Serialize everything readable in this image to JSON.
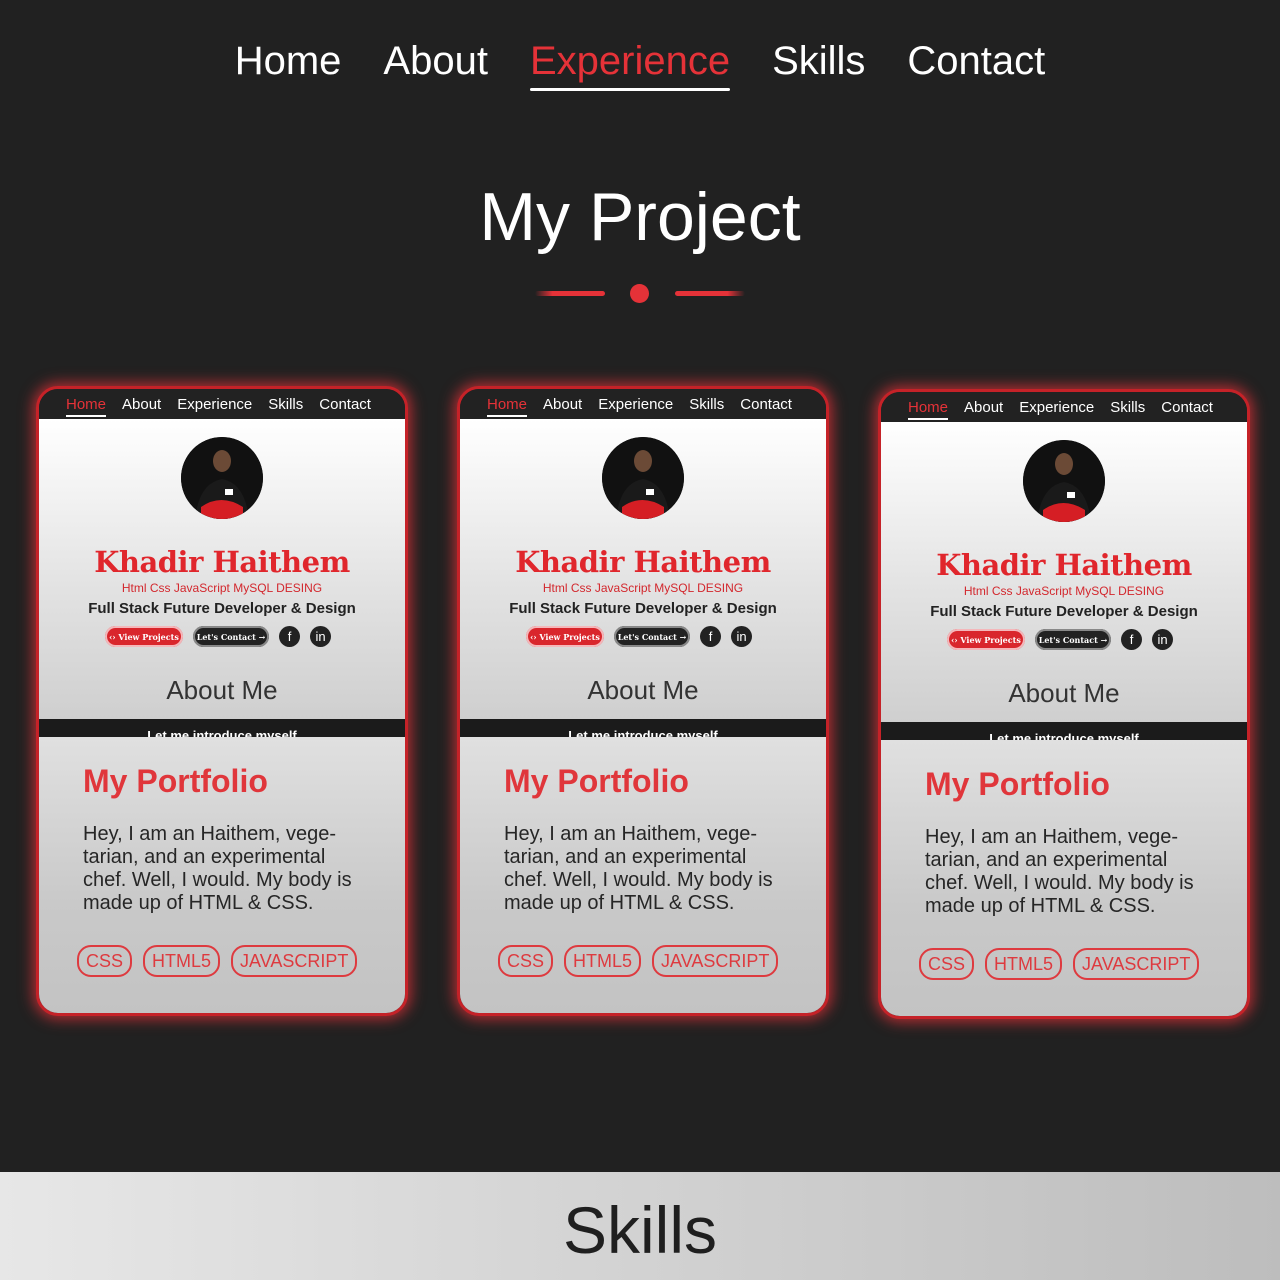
{
  "nav": {
    "items": [
      {
        "label": "Home"
      },
      {
        "label": "About"
      },
      {
        "label": "Experience",
        "active": true
      },
      {
        "label": "Skills"
      },
      {
        "label": "Contact"
      }
    ]
  },
  "section": {
    "title": "My Project"
  },
  "colors": {
    "accent": "#e53238",
    "background": "#212121"
  },
  "cards": [
    {
      "mini_nav": [
        "Home",
        "About",
        "Experience",
        "Skills",
        "Contact"
      ],
      "name": "Khadir Haithem",
      "skills_line": "Html Css JavaScript MySQL DESING",
      "role": "Full Stack Future Developer & Design",
      "btn_projects": "‹› View Projects",
      "btn_contact": "Let's Contact →",
      "social_icons": [
        "facebook-icon",
        "linkedin-icon"
      ],
      "about_heading": "About Me",
      "strip_text": "Let me introduce myself",
      "title": "My Portfolio",
      "description": "Hey, I am an Haithem, vege-tarian, and an experimental chef. Well, I would. My body is made up of HTML & CSS.",
      "tags": [
        "CSS",
        "HTML5",
        "JAVASCRIPT"
      ]
    },
    {
      "mini_nav": [
        "Home",
        "About",
        "Experience",
        "Skills",
        "Contact"
      ],
      "name": "Khadir Haithem",
      "skills_line": "Html Css JavaScript MySQL DESING",
      "role": "Full Stack Future Developer & Design",
      "btn_projects": "‹› View Projects",
      "btn_contact": "Let's Contact →",
      "social_icons": [
        "facebook-icon",
        "linkedin-icon"
      ],
      "about_heading": "About Me",
      "strip_text": "Let me introduce myself",
      "title": "My Portfolio",
      "description": "Hey, I am an Haithem, vege-tarian, and an experimental chef. Well, I would. My body is made up of HTML & CSS.",
      "tags": [
        "CSS",
        "HTML5",
        "JAVASCRIPT"
      ]
    },
    {
      "mini_nav": [
        "Home",
        "About",
        "Experience",
        "Skills",
        "Contact"
      ],
      "name": "Khadir Haithem",
      "skills_line": "Html Css JavaScript MySQL DESING",
      "role": "Full Stack Future Developer & Design",
      "btn_projects": "‹› View Projects",
      "btn_contact": "Let's Contact →",
      "social_icons": [
        "facebook-icon",
        "linkedin-icon"
      ],
      "about_heading": "About Me",
      "strip_text": "Let me introduce myself",
      "title": "My Portfolio",
      "description": "Hey, I am an Haithem, vege-tarian, and an experimental chef. Well, I would. My body is made up of HTML & CSS.",
      "tags": [
        "CSS",
        "HTML5",
        "JAVASCRIPT"
      ]
    }
  ],
  "footer": {
    "title": "Skills"
  }
}
